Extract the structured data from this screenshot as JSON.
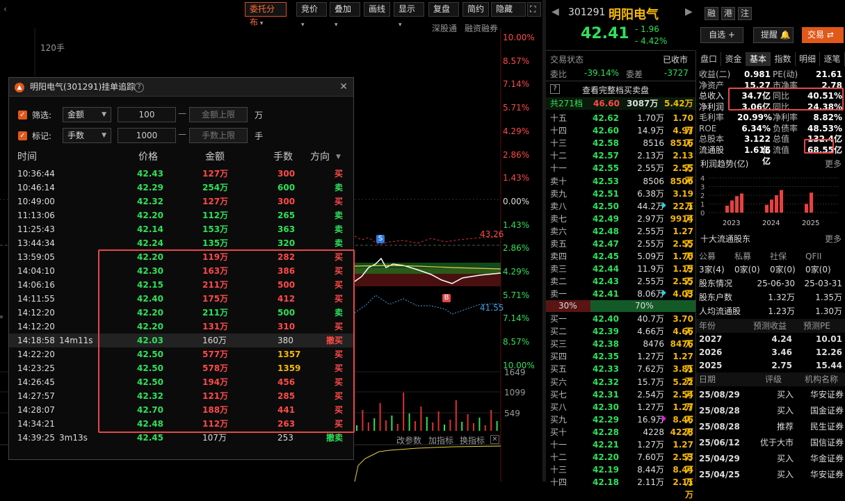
{
  "toolbar": {
    "items": [
      "委托分布",
      "竞价",
      "叠加",
      "画线",
      "显示",
      "复盘",
      "简约",
      "隐藏"
    ],
    "links": [
      "深股通",
      "融资融券"
    ],
    "bottom_links": [
      "改参数",
      "加指标",
      "换指标"
    ]
  },
  "chart": {
    "volume_label": "120手",
    "pct_labels": [
      {
        "t": "10.00%",
        "c": "up"
      },
      {
        "t": "8.57%",
        "c": "up"
      },
      {
        "t": "7.14%",
        "c": "up"
      },
      {
        "t": "5.71%",
        "c": "up"
      },
      {
        "t": "4.29%",
        "c": "up"
      },
      {
        "t": "2.86%",
        "c": "up"
      },
      {
        "t": "1.43%",
        "c": "up"
      },
      {
        "t": "0.00%",
        "c": "wh"
      },
      {
        "t": "1.43%",
        "c": "dn"
      },
      {
        "t": "2.86%",
        "c": "dn"
      },
      {
        "t": "4.29%",
        "c": "dn"
      },
      {
        "t": "5.71%",
        "c": "dn"
      },
      {
        "t": "7.14%",
        "c": "dn"
      },
      {
        "t": "8.57%",
        "c": "dn"
      },
      {
        "t": "10.00%",
        "c": "dn"
      }
    ],
    "high_label": "43.26",
    "low_label": "41.55",
    "vol_ticks": [
      "1649",
      "1099",
      "549"
    ],
    "marker_s": "S",
    "marker_b": "B"
  },
  "popup": {
    "title": "明阳电气(301291)挂单追踪",
    "filter_label": "筛选:",
    "filter_field": "金额",
    "filter_value": "100",
    "filter_upper": "金额上限",
    "filter_unit": "万",
    "mark_label": "标记:",
    "mark_field": "手数",
    "mark_value": "1000",
    "mark_upper": "手数上限",
    "mark_unit": "手",
    "headers": [
      "时间",
      "价格",
      "金额",
      "手数",
      "方向"
    ],
    "rows": [
      {
        "time": "10:36:44",
        "extra": "",
        "price": "42.43",
        "amount": "127万",
        "lots": "300",
        "dir": "买",
        "type": "buy"
      },
      {
        "time": "10:46:14",
        "extra": "",
        "price": "42.29",
        "amount": "254万",
        "lots": "600",
        "dir": "卖",
        "type": "sell"
      },
      {
        "time": "10:49:00",
        "extra": "",
        "price": "42.32",
        "amount": "127万",
        "lots": "300",
        "dir": "买",
        "type": "buy"
      },
      {
        "time": "11:13:06",
        "extra": "",
        "price": "42.20",
        "amount": "112万",
        "lots": "265",
        "dir": "卖",
        "type": "sell"
      },
      {
        "time": "11:25:43",
        "extra": "",
        "price": "42.14",
        "amount": "153万",
        "lots": "363",
        "dir": "卖",
        "type": "sell"
      },
      {
        "time": "13:44:34",
        "extra": "",
        "price": "42.24",
        "amount": "135万",
        "lots": "320",
        "dir": "卖",
        "type": "sell"
      },
      {
        "time": "13:59:05",
        "extra": "",
        "price": "42.20",
        "amount": "119万",
        "lots": "282",
        "dir": "买",
        "type": "buy"
      },
      {
        "time": "14:04:10",
        "extra": "",
        "price": "42.30",
        "amount": "163万",
        "lots": "386",
        "dir": "买",
        "type": "buy"
      },
      {
        "time": "14:06:16",
        "extra": "",
        "price": "42.15",
        "amount": "211万",
        "lots": "500",
        "dir": "买",
        "type": "buy"
      },
      {
        "time": "14:11:55",
        "extra": "",
        "price": "42.40",
        "amount": "175万",
        "lots": "412",
        "dir": "买",
        "type": "buy"
      },
      {
        "time": "14:12:20",
        "extra": "",
        "price": "42.20",
        "amount": "211万",
        "lots": "500",
        "dir": "卖",
        "type": "sell"
      },
      {
        "time": "14:12:20",
        "extra": "",
        "price": "42.20",
        "amount": "131万",
        "lots": "310",
        "dir": "买",
        "type": "buy"
      },
      {
        "time": "14:18:58",
        "extra": "14m11s",
        "price": "42.03",
        "amount": "160万",
        "lots": "380",
        "dir": "撤买",
        "type": "cancel-buy"
      },
      {
        "time": "14:22:20",
        "extra": "",
        "price": "42.50",
        "amount": "577万",
        "lots": "1357",
        "dir": "买",
        "type": "big-buy"
      },
      {
        "time": "14:23:25",
        "extra": "",
        "price": "42.50",
        "amount": "578万",
        "lots": "1359",
        "dir": "买",
        "type": "big-buy"
      },
      {
        "time": "14:26:45",
        "extra": "",
        "price": "42.50",
        "amount": "194万",
        "lots": "456",
        "dir": "买",
        "type": "buy"
      },
      {
        "time": "14:27:57",
        "extra": "",
        "price": "42.32",
        "amount": "121万",
        "lots": "285",
        "dir": "买",
        "type": "buy"
      },
      {
        "time": "14:28:07",
        "extra": "",
        "price": "42.70",
        "amount": "188万",
        "lots": "441",
        "dir": "买",
        "type": "buy"
      },
      {
        "time": "14:34:21",
        "extra": "",
        "price": "42.48",
        "amount": "112万",
        "lots": "263",
        "dir": "买",
        "type": "buy"
      },
      {
        "time": "14:39:25",
        "extra": "3m13s",
        "price": "42.45",
        "amount": "107万",
        "lots": "253",
        "dir": "撤卖",
        "type": "cancel-sell"
      }
    ]
  },
  "quote": {
    "code": "301291",
    "name": "明阳电气",
    "tags": [
      "融",
      "港",
      "注"
    ],
    "price": "42.41",
    "change": "- 1.96",
    "change_pct": "- 4.42%",
    "btn_watch": "自选 +",
    "btn_alert": "提醒",
    "btn_trade": "交易",
    "status_label": "交易状态",
    "status_value": "已收市",
    "ratio_label": "委比",
    "ratio_value": "-39.14%",
    "diff_label": "委差",
    "diff_value": "-3727",
    "full_book": "查看完整档买卖盘",
    "total_label": "共271档",
    "total_price": "46.60",
    "total_lots": "3087万",
    "total_amt": "5.42万",
    "sell_pct": "30%",
    "buy_pct": "70%"
  },
  "book": {
    "asks": [
      {
        "l": "十五",
        "p": "42.62",
        "v": "1.70万",
        "a": "1.70万"
      },
      {
        "l": "十四",
        "p": "42.60",
        "v": "14.9万",
        "a": "4.97万"
      },
      {
        "l": "十三",
        "p": "42.58",
        "v": "8516",
        "a": "8516"
      },
      {
        "l": "十二",
        "p": "42.57",
        "v": "2.13万",
        "a": "2.13万"
      },
      {
        "l": "十一",
        "p": "42.55",
        "v": "2.55万",
        "a": "2.55万"
      },
      {
        "l": "卖十",
        "p": "42.53",
        "v": "8506",
        "a": "8506"
      },
      {
        "l": "卖九",
        "p": "42.51",
        "v": "6.38万",
        "a": "3.19万"
      },
      {
        "l": "卖八",
        "p": "42.50",
        "v": "44.2万",
        "a": "22.1万",
        "m": "cyan"
      },
      {
        "l": "卖七",
        "p": "42.49",
        "v": "2.97万",
        "a": "9914"
      },
      {
        "l": "卖六",
        "p": "42.48",
        "v": "2.55万",
        "a": "1.27万"
      },
      {
        "l": "卖五",
        "p": "42.47",
        "v": "2.55万",
        "a": "2.55万"
      },
      {
        "l": "卖四",
        "p": "42.45",
        "v": "5.09万",
        "a": "1.70万"
      },
      {
        "l": "卖三",
        "p": "42.44",
        "v": "11.9万",
        "a": "1.19万"
      },
      {
        "l": "卖二",
        "p": "42.43",
        "v": "2.55万",
        "a": "2.55万"
      },
      {
        "l": "卖一",
        "p": "42.41",
        "v": "8.06万",
        "a": "4.03万",
        "m": "cyan"
      }
    ],
    "bids": [
      {
        "l": "买一",
        "p": "42.40",
        "v": "40.7万",
        "a": "3.70万"
      },
      {
        "l": "买二",
        "p": "42.39",
        "v": "4.66万",
        "a": "4.66万"
      },
      {
        "l": "买三",
        "p": "42.38",
        "v": "8476",
        "a": "8476"
      },
      {
        "l": "买四",
        "p": "42.35",
        "v": "1.27万",
        "a": "1.27万"
      },
      {
        "l": "买五",
        "p": "42.33",
        "v": "7.62万",
        "a": "3.81万"
      },
      {
        "l": "买六",
        "p": "42.32",
        "v": "15.7万",
        "a": "5.22万"
      },
      {
        "l": "买七",
        "p": "42.31",
        "v": "2.54万",
        "a": "2.54万"
      },
      {
        "l": "买八",
        "p": "42.30",
        "v": "1.27万",
        "a": "1.27万"
      },
      {
        "l": "买九",
        "p": "42.29",
        "v": "16.9万",
        "a": "8.46万",
        "m": "magenta"
      },
      {
        "l": "买十",
        "p": "42.28",
        "v": "4228",
        "a": "4228"
      },
      {
        "l": "十一",
        "p": "42.21",
        "v": "1.27万",
        "a": "1.27万"
      },
      {
        "l": "十二",
        "p": "42.20",
        "v": "7.60万",
        "a": "2.53万"
      },
      {
        "l": "十三",
        "p": "42.19",
        "v": "8.44万",
        "a": "8.44万"
      },
      {
        "l": "十四",
        "p": "42.18",
        "v": "2.11万",
        "a": "2.11万"
      }
    ]
  },
  "tabs": [
    "盘口",
    "资金",
    "基本",
    "指数",
    "明细",
    "逐笔"
  ],
  "fund": {
    "rows": [
      {
        "k1": "收益(二)",
        "v1": "0.981",
        "k2": "PE(动)",
        "v2": "21.61"
      },
      {
        "k1": "净资产",
        "v1": "15.27",
        "k2": "市净率",
        "v2": "2.78"
      },
      {
        "k1": "总收入",
        "v1": "34.7亿",
        "k2": "同比",
        "v2": "40.51%"
      },
      {
        "k1": "净利润",
        "v1": "3.06亿",
        "k2": "同比",
        "v2": "24.38%"
      },
      {
        "k1": "毛利率",
        "v1": "20.99%",
        "k2": "净利率",
        "v2": "8.82%"
      },
      {
        "k1": "ROE",
        "v1": "6.34%",
        "k2": "负债率",
        "v2": "48.53%"
      },
      {
        "k1": "总股本",
        "v1": "3.122亿",
        "k2": "总值",
        "v2": "132.4亿"
      },
      {
        "k1": "流通股",
        "v1": "1.616亿",
        "k2": "流值",
        "v2": "68.55亿"
      }
    ],
    "profit_title": "利润趋势(亿)",
    "more": "更多",
    "y_ticks": [
      "4",
      "3",
      "2",
      "1",
      "0"
    ],
    "years": [
      "2023",
      "2024",
      "2025"
    ],
    "profit_values": [
      0.8,
      1.4,
      1.9,
      2.2,
      0.9,
      1.5,
      2.0,
      2.6,
      1.0,
      2.3
    ],
    "holders_title": "十大流通股东",
    "holder_heads": [
      "公募",
      "私募",
      "社保",
      "QFII"
    ],
    "holder_vals": [
      "3家(4)",
      "0家(0)",
      "0家(0)",
      "0家(0)"
    ],
    "share_rows": [
      {
        "k": "股东情况",
        "a": "25-06-30",
        "b": "25-03-31"
      },
      {
        "k": "股东户数",
        "a": "1.32万",
        "b": "1.35万"
      },
      {
        "k": "人均流通股",
        "a": "1.23万",
        "b": "1.30万"
      }
    ],
    "fc_heads": [
      "年份",
      "预测收益",
      "预测PE"
    ],
    "fc_rows": [
      {
        "y": "2027",
        "e": "4.24",
        "pe": "10.01"
      },
      {
        "y": "2026",
        "e": "3.46",
        "pe": "12.26"
      },
      {
        "y": "2025",
        "e": "2.75",
        "pe": "15.44"
      }
    ],
    "rt_heads": [
      "日期",
      "评级",
      "机构名称"
    ],
    "rt_rows": [
      {
        "d": "25/08/29",
        "r": "买入",
        "o": "华安证券"
      },
      {
        "d": "25/08/28",
        "r": "买入",
        "o": "国金证券"
      },
      {
        "d": "25/08/28",
        "r": "推荐",
        "o": "民生证券"
      },
      {
        "d": "25/06/12",
        "r": "优于大市",
        "o": "国信证券"
      },
      {
        "d": "25/04/29",
        "r": "买入",
        "o": "华金证券"
      },
      {
        "d": "25/04/25",
        "r": "买入",
        "o": "华安证券"
      }
    ]
  }
}
